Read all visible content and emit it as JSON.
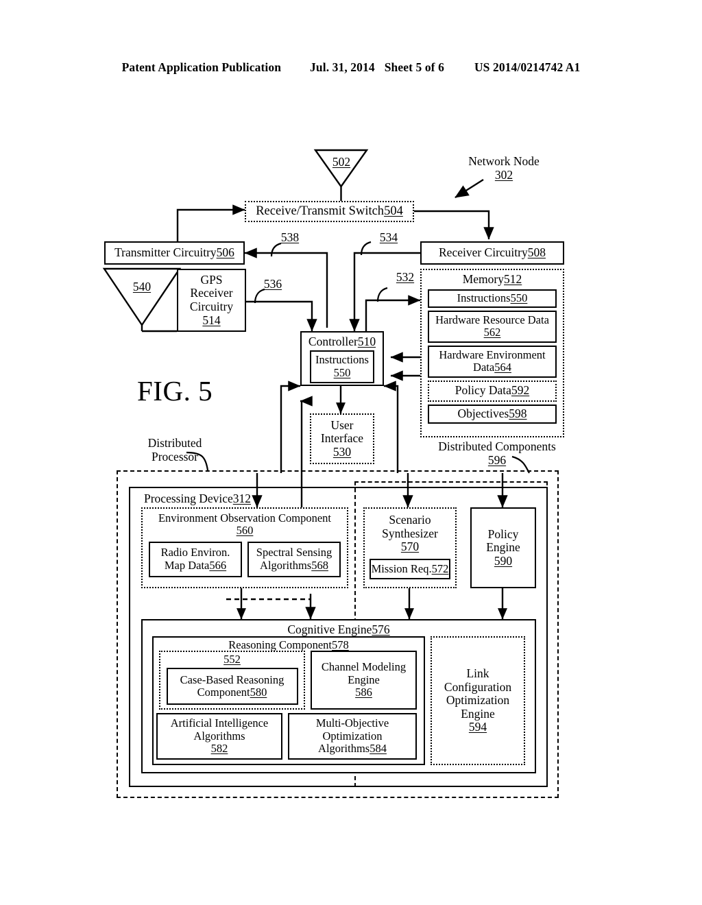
{
  "header": {
    "publication": "Patent Application Publication",
    "date": "Jul. 31, 2014",
    "sheet": "Sheet 5 of 6",
    "number": "US 2014/0214742 A1"
  },
  "figure": {
    "label": "FIG. 5"
  },
  "callouts": {
    "network_node": "Network Node",
    "network_node_ref": "302",
    "distributed_processor_l1": "Distributed",
    "distributed_processor_l2": "Processor",
    "distributed_components": "Distributed Components",
    "distributed_components_ref": "596"
  },
  "antennas": {
    "main": "502",
    "gps": "540"
  },
  "connector_refs": {
    "tx_from_ctrl": "538",
    "rx_to_ctrl": "534",
    "gps_to_ctrl": "536",
    "ctrl_to_mem": "532"
  },
  "blocks": {
    "switch": "Receive/Transmit Switch ",
    "switch_ref": "504",
    "transmitter": "Transmitter Circuitry ",
    "transmitter_ref": "506",
    "receiver": "Receiver Circuitry ",
    "receiver_ref": "508",
    "gps_l1": "GPS",
    "gps_l2": "Receiver",
    "gps_l3": "Circuitry",
    "gps_ref": "514",
    "controller": "Controller ",
    "controller_ref": "510",
    "ctrl_instructions": "Instructions",
    "ctrl_instructions_ref": "550",
    "user_interface_l1": "User",
    "user_interface_l2": "Interface",
    "user_interface_ref": "530"
  },
  "memory": {
    "title": "Memory ",
    "title_ref": "512",
    "items": [
      {
        "text": "Instructions ",
        "ref": "550",
        "style": "solid"
      },
      {
        "text": "Hardware Resource Data",
        "ref": "562",
        "style": "solid"
      },
      {
        "text": "Hardware Environment",
        "text2": "Data ",
        "ref": "564",
        "style": "solid"
      },
      {
        "text": "Policy Data ",
        "ref": "592",
        "style": "dotted"
      },
      {
        "text": "Objectives ",
        "ref": "598",
        "style": "solid"
      }
    ]
  },
  "processing_device": {
    "title": "Processing Device ",
    "title_ref": "312",
    "environment_observation": {
      "title_l1": "Environment Observation Component",
      "ref": "560",
      "children": [
        {
          "l1": "Radio Environ.",
          "l2": "Map Data ",
          "ref": "566"
        },
        {
          "l1": "Spectral Sensing",
          "l2": "Algorithms ",
          "ref": "568"
        }
      ]
    },
    "scenario_synthesizer": {
      "l1": "Scenario",
      "l2": "Synthesizer",
      "ref": "570",
      "child": {
        "text": "Mission Req. ",
        "ref": "572"
      }
    },
    "policy_engine": {
      "l1": "Policy",
      "l2": "Engine",
      "ref": "590"
    },
    "cognitive_engine": {
      "title": "Cognitive Engine ",
      "title_ref": "576",
      "reasoning_component": {
        "title": "Reasoning Component ",
        "title_ref": "578",
        "group_ref": "552",
        "case_based": {
          "l1": "Case-Based Reasoning",
          "l2": "Component ",
          "ref": "580"
        },
        "channel_modeling": {
          "l1": "Channel Modeling",
          "l2": "Engine",
          "ref": "586"
        },
        "ai_algorithms": {
          "l1": "Artificial Intelligence",
          "l2": "Algorithms",
          "ref": "582"
        },
        "multi_objective": {
          "l1": "Multi-Objective",
          "l2": "Optimization",
          "l3": "Algorithms ",
          "ref": "584"
        }
      },
      "link_config": {
        "l1": "Link",
        "l2": "Configuration",
        "l3": "Optimization",
        "l4": "Engine",
        "ref": "594"
      }
    }
  }
}
